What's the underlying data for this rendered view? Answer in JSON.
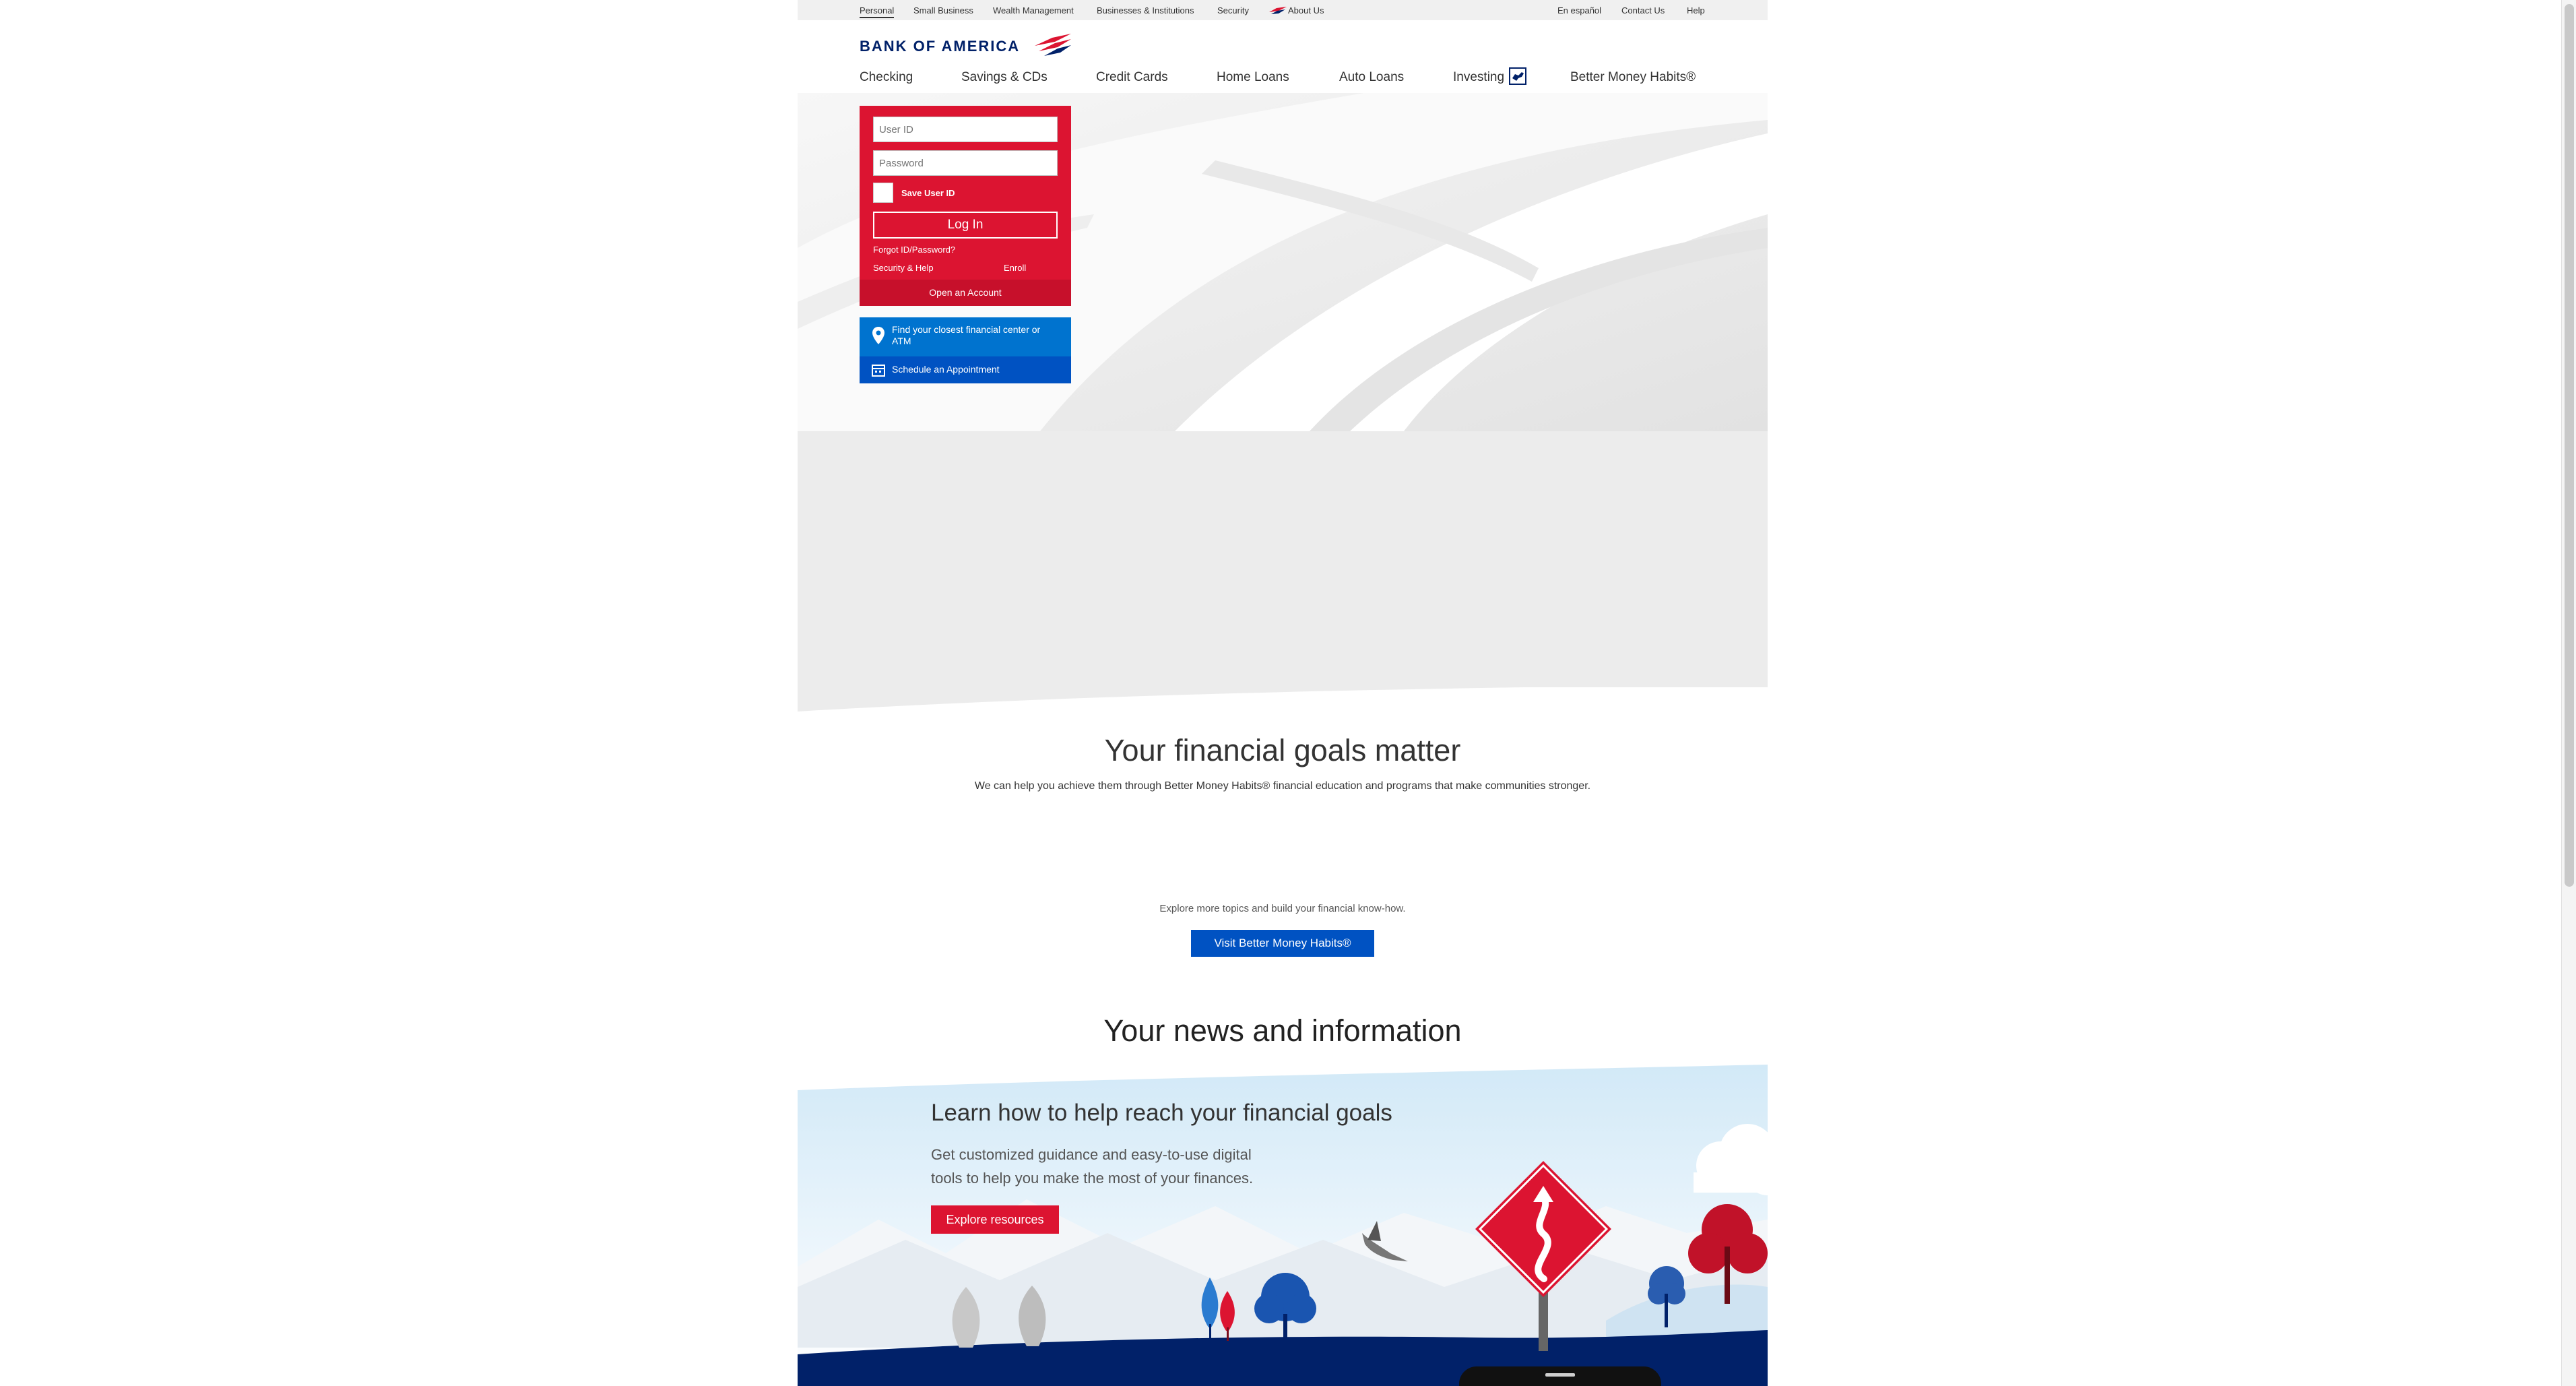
{
  "util_nav": {
    "personal": "Personal",
    "small_business": "Small Business",
    "wealth_management": "Wealth Management",
    "businesses_institutions": "Businesses & Institutions",
    "security": "Security",
    "about_us": "About Us",
    "en_espanol": "En español",
    "contact_us": "Contact Us",
    "help": "Help"
  },
  "logo": {
    "text": "BANK OF AMERICA"
  },
  "main_nav": {
    "checking": "Checking",
    "savings": "Savings & CDs",
    "credit_cards": "Credit Cards",
    "home_loans": "Home Loans",
    "auto_loans": "Auto Loans",
    "investing": "Investing",
    "better_money_habits": "Better Money Habits®"
  },
  "login": {
    "user_id_placeholder": "User ID",
    "password_placeholder": "Password",
    "save_user_id": "Save User ID",
    "login_button": "Log In",
    "forgot": "Forgot ID/Password?",
    "security_help": "Security & Help",
    "enroll": "Enroll",
    "open_account": "Open an Account"
  },
  "locator": {
    "find_center": "Find your closest financial center or ATM",
    "schedule": "Schedule an Appointment"
  },
  "goals": {
    "title": "Your financial goals matter",
    "subtitle": "We can help you achieve them through Better Money Habits® financial education and programs that make communities stronger.",
    "explore_text": "Explore more topics and build your financial know-how.",
    "bmh_button": "Visit Better Money Habits®"
  },
  "news": {
    "title": "Your news and information"
  },
  "promo": {
    "title": "Learn how to help reach your financial goals",
    "body": "Get customized guidance and easy-to-use digital tools to help you make the most of your finances.",
    "button": "Explore resources"
  },
  "colors": {
    "brand_red": "#dc1431",
    "brand_navy": "#012169",
    "brand_blue": "#0073cf",
    "button_blue": "#0052c2"
  }
}
